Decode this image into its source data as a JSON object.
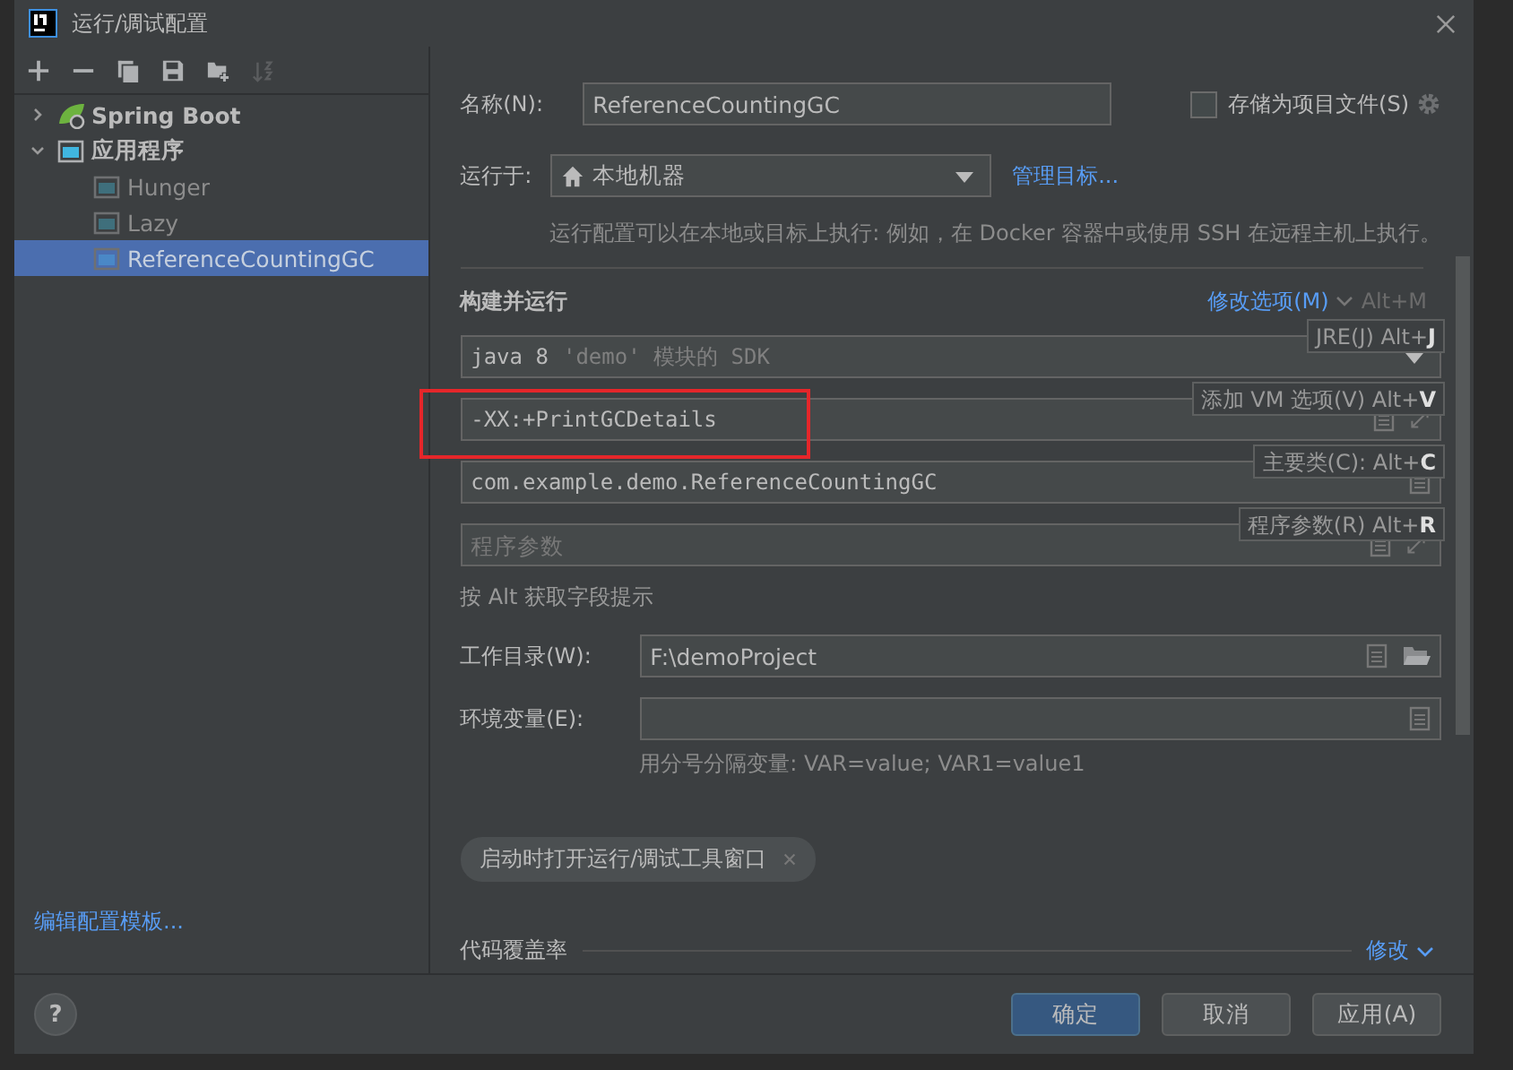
{
  "window": {
    "title": "运行/调试配置"
  },
  "toolbar": [
    {
      "kind": "add",
      "disabled": false
    },
    {
      "kind": "remove",
      "disabled": false
    },
    {
      "kind": "copy",
      "disabled": false
    },
    {
      "kind": "save",
      "disabled": false
    },
    {
      "kind": "folder",
      "disabled": false
    },
    {
      "kind": "sort",
      "disabled": true
    }
  ],
  "tree": [
    {
      "label": "Spring Boot",
      "kind": "spring",
      "expanded": false,
      "selected": false
    },
    {
      "label": "应用程序",
      "kind": "application",
      "expanded": true,
      "selected": false,
      "children": [
        {
          "label": "Hunger",
          "selected": false
        },
        {
          "label": "Lazy",
          "selected": false
        },
        {
          "label": "ReferenceCountingGC",
          "selected": true
        }
      ]
    }
  ],
  "templates_link": "编辑配置模板...",
  "form": {
    "name_label": "名称(N):",
    "name_value": "ReferenceCountingGC",
    "store_checkbox": {
      "label": "存储为项目文件(S)",
      "checked": false
    },
    "run_on_label": "运行于:",
    "run_on_value": "本地机器",
    "manage_link": "管理目标...",
    "run_on_hint": "运行配置可以在本地或目标上执行: 例如，在 Docker 容器中或使用 SSH 在远程主机上执行。",
    "section_title": "构建并运行",
    "modify_link": "修改选项(M)",
    "modify_shortcut": "Alt+M",
    "sdk": {
      "version": "java 8",
      "detail": "'demo' 模块的 SDK"
    },
    "vm_options": "-XX:+PrintGCDetails",
    "main_class": "com.example.demo.ReferenceCountingGC",
    "program_args": {
      "placeholder": "程序参数"
    },
    "alt_hint": "按 Alt 获取字段提示",
    "workdir_label": "工作目录(W):",
    "workdir_value": "F:\\demoProject",
    "env_label": "环境变量(E):",
    "env_hint": "用分号分隔变量: VAR=value; VAR1=value1",
    "chip": "启动时打开运行/调试工具窗口",
    "coverage_label": "代码覆盖率",
    "coverage_link": "修改"
  },
  "tooltips": [
    "JRE(J) Alt+**J**",
    "添加 VM 选项(V) Alt+**V**",
    "主要类(C): Alt+**C**",
    "程序参数(R) Alt+**R**"
  ],
  "help": "?",
  "buttons": [
    {
      "label": "确定",
      "kind": "primary"
    },
    {
      "label": "取消",
      "kind": "normal"
    },
    {
      "label": "应用(A)",
      "kind": "normal"
    }
  ]
}
